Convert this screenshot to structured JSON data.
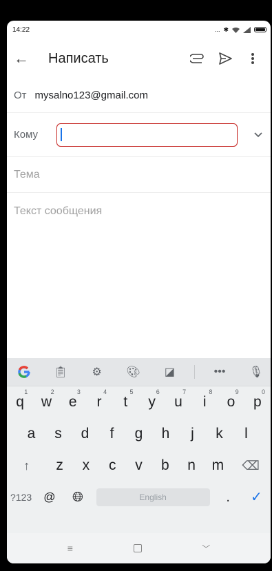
{
  "status": {
    "time": "14:22",
    "dots": "..."
  },
  "appbar": {
    "title": "Написать"
  },
  "compose": {
    "from_label": "От",
    "from_value": "mysalno123@gmail.com",
    "to_label": "Кому",
    "to_value": "",
    "subject_placeholder": "Тема",
    "body_placeholder": "Текст сообщения"
  },
  "keyboard": {
    "row1": [
      {
        "k": "q",
        "n": "1"
      },
      {
        "k": "w",
        "n": "2"
      },
      {
        "k": "e",
        "n": "3"
      },
      {
        "k": "r",
        "n": "4"
      },
      {
        "k": "t",
        "n": "5"
      },
      {
        "k": "y",
        "n": "6"
      },
      {
        "k": "u",
        "n": "7"
      },
      {
        "k": "i",
        "n": "8"
      },
      {
        "k": "o",
        "n": "9"
      },
      {
        "k": "p",
        "n": "0"
      }
    ],
    "row2": [
      "a",
      "s",
      "d",
      "f",
      "g",
      "h",
      "j",
      "k",
      "l"
    ],
    "row3": [
      "z",
      "x",
      "c",
      "v",
      "b",
      "n",
      "m"
    ],
    "symbols_label": "?123",
    "at_label": "@",
    "space_label": "English",
    "period_label": "."
  },
  "colors": {
    "accent": "#1a73e8",
    "error": "#c5221f"
  }
}
